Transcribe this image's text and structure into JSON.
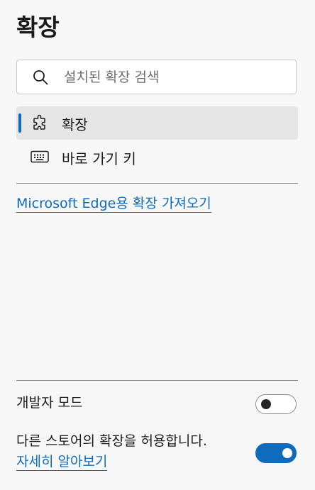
{
  "page": {
    "title": "확장"
  },
  "search": {
    "placeholder": "설치된 확장 검색",
    "value": ""
  },
  "nav": {
    "items": [
      {
        "label": "확장",
        "icon": "puzzle-icon",
        "selected": true
      },
      {
        "label": "바로 가기 키",
        "icon": "keyboard-icon",
        "selected": false
      }
    ]
  },
  "store_link": {
    "label": "Microsoft Edge용 확장 가져오기"
  },
  "settings": {
    "developer_mode": {
      "label": "개발자 모드",
      "enabled": false
    },
    "other_stores": {
      "label": "다른 스토어의 확장을 허용합니다.",
      "link_label": "자세히 알아보기",
      "enabled": true
    }
  },
  "colors": {
    "accent": "#0f6cbd",
    "background": "#f7f7f7",
    "selected_background": "#e5e5e5",
    "text": "#1b1b1b"
  }
}
